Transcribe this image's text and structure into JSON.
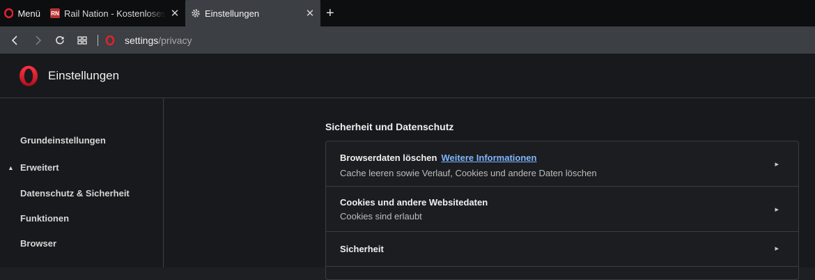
{
  "tabstrip": {
    "menu_label": "Menü",
    "tabs": [
      {
        "title": "Rail Nation - Kostenloses Strategiespiel",
        "favicon": "rail-nation-favicon"
      },
      {
        "title": "Einstellungen",
        "favicon": "gear-icon"
      }
    ],
    "new_tab_symbol": "+"
  },
  "toolbar": {
    "url_host": "settings",
    "url_path": "/privacy"
  },
  "header": {
    "title": "Einstellungen"
  },
  "sidebar": {
    "items": [
      {
        "label": "Grundeinstellungen"
      },
      {
        "label": "Erweitert",
        "expanded": true
      },
      {
        "label": "Datenschutz & Sicherheit"
      },
      {
        "label": "Funktionen"
      },
      {
        "label": "Browser"
      }
    ]
  },
  "main": {
    "section_title": "Sicherheit und Datenschutz",
    "rows": [
      {
        "title": "Browserdaten löschen",
        "link": "Weitere Informationen",
        "subtitle": "Cache leeren sowie Verlauf, Cookies und andere Daten löschen"
      },
      {
        "title": "Cookies und andere Websitedaten",
        "subtitle": "Cookies sind erlaubt"
      },
      {
        "title": "Sicherheit"
      }
    ]
  },
  "colors": {
    "opera_red": "#e0222d",
    "link_blue": "#7fb6ff"
  }
}
